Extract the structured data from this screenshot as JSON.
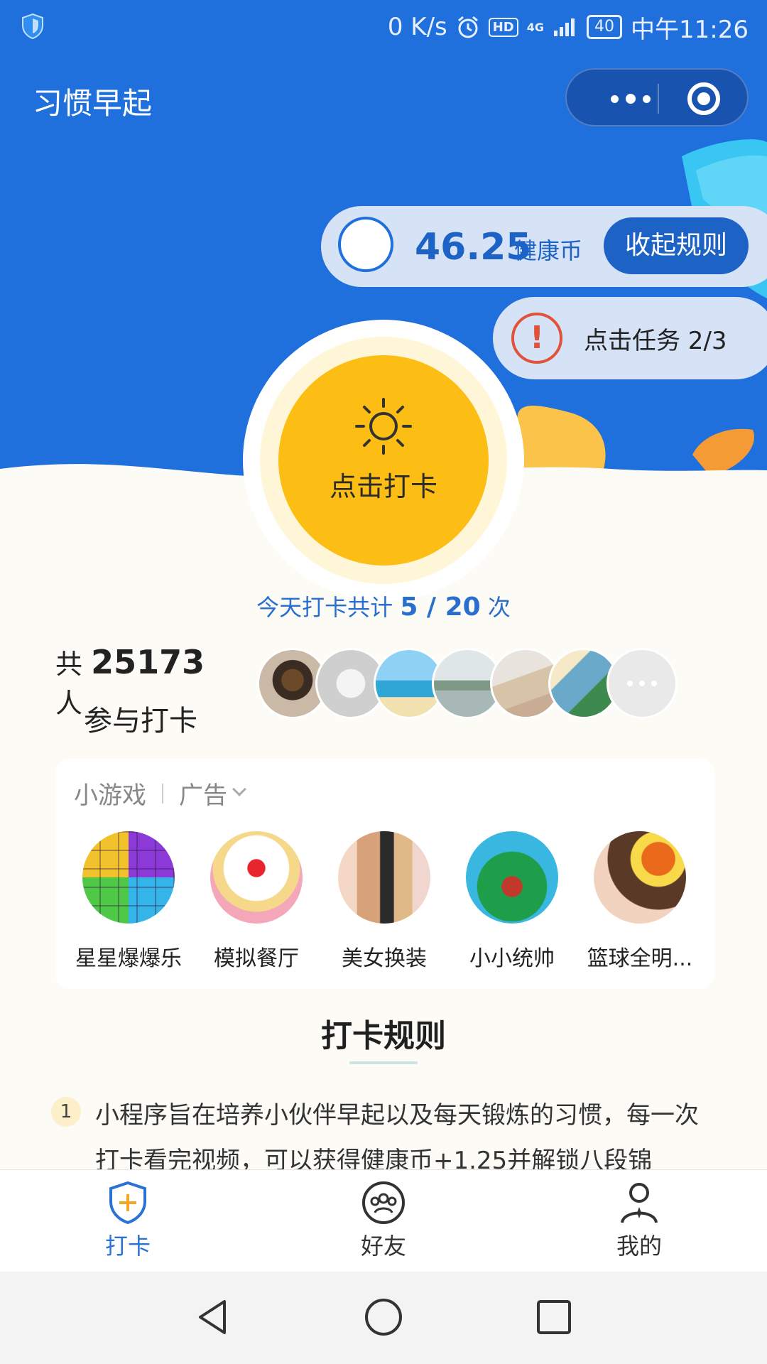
{
  "status_bar": {
    "speed": "0 K/s",
    "hd": "HD",
    "network": "4G",
    "battery": "40",
    "time": "中午11:26"
  },
  "header": {
    "title": "习惯早起",
    "more_icon": "ellipsis-icon",
    "close_icon": "target-icon"
  },
  "coins": {
    "value": "46.25",
    "unit": "健康币",
    "collapse_label": "收起规则"
  },
  "task": {
    "icon": "exclamation-icon",
    "label": "点击任务 2/3"
  },
  "checkin": {
    "icon": "sun-icon",
    "label": "点击打卡"
  },
  "today": {
    "prefix": "今天打卡共计",
    "count": "5 / 20",
    "suffix": "次"
  },
  "participants": {
    "prefix": "共",
    "count": "25173",
    "suffix": "人",
    "line2": "参与打卡"
  },
  "games": {
    "title": "小游戏",
    "ad_label": "广告",
    "items": [
      {
        "name": "星星爆爆乐"
      },
      {
        "name": "模拟餐厅"
      },
      {
        "name": "美女换装"
      },
      {
        "name": "小小统帅"
      },
      {
        "name": "篮球全明..."
      }
    ]
  },
  "rules": {
    "title": "打卡规则",
    "items": [
      {
        "num": "1",
        "text": "小程序旨在培养小伙伴早起以及每天锻炼的习惯，每一次打卡看完视频，可以获得健康币+1.25并解锁八段锦"
      }
    ]
  },
  "tabbar": {
    "items": [
      {
        "label": "打卡",
        "icon": "shield-plus-icon",
        "active": true
      },
      {
        "label": "好友",
        "icon": "friends-icon",
        "active": false
      },
      {
        "label": "我的",
        "icon": "profile-icon",
        "active": false
      }
    ],
    "active_color": "#2a72d4",
    "inactive_color": "#333333"
  },
  "colors": {
    "header_blue": "#1f6fdc",
    "checkin_yellow": "#fcbd15",
    "alert_red": "#e0533a"
  }
}
